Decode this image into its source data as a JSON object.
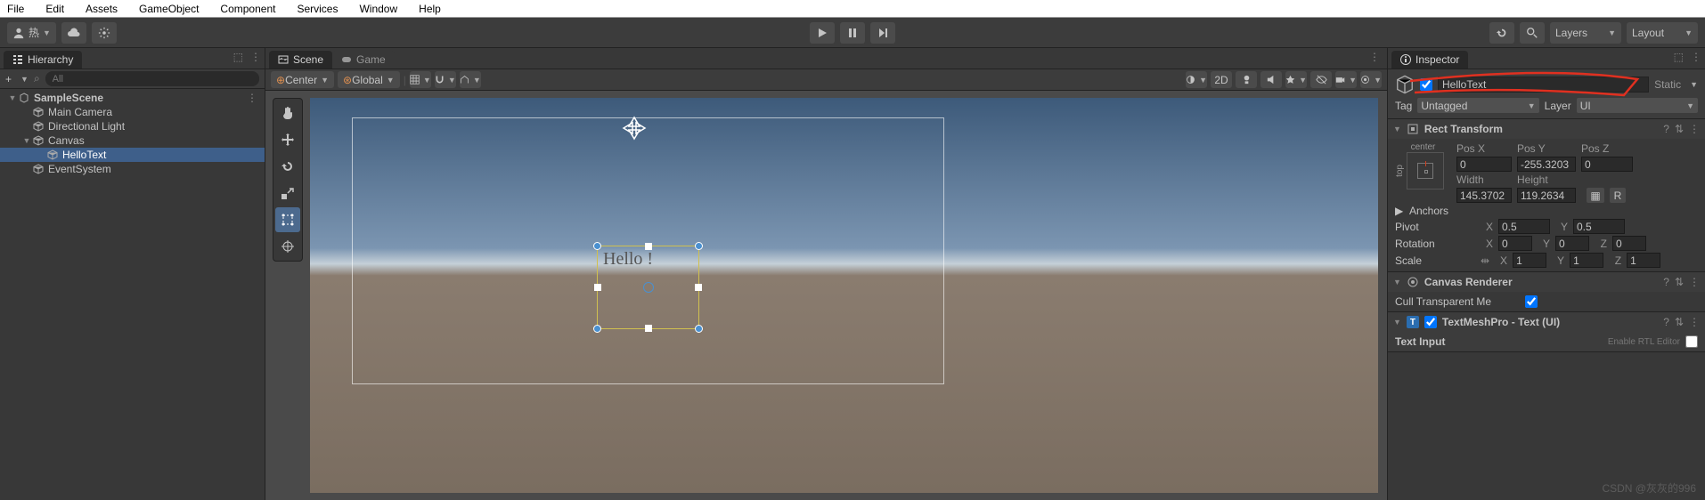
{
  "menubar": [
    "File",
    "Edit",
    "Assets",
    "GameObject",
    "Component",
    "Services",
    "Window",
    "Help"
  ],
  "toolbar": {
    "account": "热",
    "layers_drop": "Layers",
    "layout_drop": "Layout"
  },
  "hierarchy": {
    "panel_title": "Hierarchy",
    "search_placeholder": "All",
    "tree": [
      {
        "depth": 0,
        "fold": "▼",
        "icon": "unity",
        "label": "SampleScene",
        "bold": true
      },
      {
        "depth": 1,
        "fold": "",
        "icon": "cube",
        "label": "Main Camera"
      },
      {
        "depth": 1,
        "fold": "",
        "icon": "cube",
        "label": "Directional Light"
      },
      {
        "depth": 1,
        "fold": "▼",
        "icon": "cube",
        "label": "Canvas"
      },
      {
        "depth": 2,
        "fold": "",
        "icon": "cube",
        "label": "HelloText",
        "selected": true
      },
      {
        "depth": 1,
        "fold": "",
        "icon": "cube",
        "label": "EventSystem"
      }
    ]
  },
  "scene": {
    "tabs": [
      {
        "label": "Scene",
        "active": true
      },
      {
        "label": "Game",
        "active": false
      }
    ],
    "pivot": "Center",
    "handle": "Global",
    "mode_2d": "2D",
    "selected_text": "Hello !"
  },
  "inspector": {
    "panel_title": "Inspector",
    "name": "HelloText",
    "static": "Static",
    "tag_label": "Tag",
    "tag": "Untagged",
    "layer_label": "Layer",
    "layer": "UI",
    "rect_transform": {
      "title": "Rect Transform",
      "anchor_x": "center",
      "anchor_y": "top",
      "posx_label": "Pos X",
      "posx": "0",
      "posy_label": "Pos Y",
      "posy": "-255.3203",
      "posz_label": "Pos Z",
      "posz": "0",
      "width_label": "Width",
      "width": "145.3702",
      "height_label": "Height",
      "height": "119.2634",
      "anchors": "Anchors",
      "pivot": "Pivot",
      "pivot_x": "0.5",
      "pivot_y": "0.5",
      "rotation": "Rotation",
      "rot_x": "0",
      "rot_y": "0",
      "rot_z": "0",
      "scale": "Scale",
      "scale_x": "1",
      "scale_y": "1",
      "scale_z": "1",
      "r_btn": "R"
    },
    "canvas_renderer": {
      "title": "Canvas Renderer",
      "cull": "Cull Transparent Me"
    },
    "tmp": {
      "title": "TextMeshPro - Text (UI)",
      "text_input": "Text Input",
      "text_input_hint": "Enable RTL Editor"
    }
  }
}
